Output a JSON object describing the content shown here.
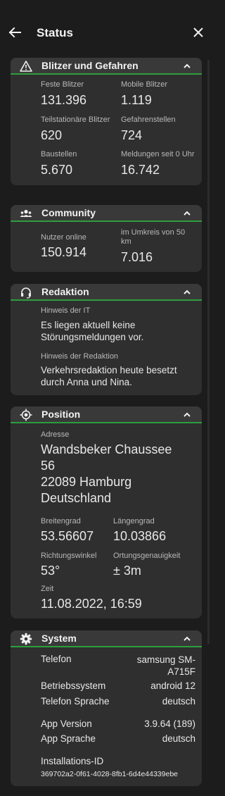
{
  "header": {
    "title": "Status"
  },
  "blitzer": {
    "title": "Blitzer und Gefahren",
    "feste_label": "Feste Blitzer",
    "feste_value": "131.396",
    "mobile_label": "Mobile Blitzer",
    "mobile_value": "1.119",
    "teil_label": "Teilstationäre Blitzer",
    "teil_value": "620",
    "gefahren_label": "Gefahrenstellen",
    "gefahren_value": "724",
    "baustellen_label": "Baustellen",
    "baustellen_value": "5.670",
    "meldungen_label": "Meldungen seit 0 Uhr",
    "meldungen_value": "16.742"
  },
  "community": {
    "title": "Community",
    "online_label": "Nutzer online",
    "online_value": "150.914",
    "umkreis_label": "im Umkreis von 50 km",
    "umkreis_value": "7.016"
  },
  "redaktion": {
    "title": "Redaktion",
    "it_label": "Hinweis der IT",
    "it_text": "Es liegen aktuell keine Störungsmeldungen vor.",
    "red_label": "Hinweis der Redaktion",
    "red_text": "Verkehrsredaktion heute besetzt durch Anna und Nina."
  },
  "position": {
    "title": "Position",
    "address_label": "Adresse",
    "address_line1": "Wandsbeker Chaussee",
    "address_line2": "56",
    "address_line3": "22089 Hamburg",
    "address_line4": "Deutschland",
    "lat_label": "Breitengrad",
    "lat_value": "53.56607",
    "lon_label": "Längengrad",
    "lon_value": "10.03866",
    "dir_label": "Richtungswinkel",
    "dir_value": "53°",
    "acc_label": "Ortungsgenauigkeit",
    "acc_value": "± 3m",
    "time_label": "Zeit",
    "time_value": "11.08.2022, 16:59"
  },
  "system": {
    "title": "System",
    "phone_label": "Telefon",
    "phone_value": "samsung SM-A715F",
    "os_label": "Betriebssystem",
    "os_value": "android 12",
    "lang_label": "Telefon Sprache",
    "lang_value": "deutsch",
    "appver_label": "App Version",
    "appver_value": "3.9.64 (189)",
    "applang_label": "App Sprache",
    "applang_value": "deutsch",
    "install_label": "Installations-ID",
    "install_value": "369702a2-0f61-4028-8fb1-6d4e44339ebe"
  },
  "colors": {
    "accent": "#2e9d3e",
    "card": "#2f2f2f",
    "card_header": "#393939",
    "background": "#1c1c1c"
  },
  "icons": [
    "back-arrow-icon",
    "close-icon",
    "warning-triangle-icon",
    "community-group-icon",
    "headset-icon",
    "location-target-icon",
    "gear-icon",
    "chevron-up-icon"
  ]
}
